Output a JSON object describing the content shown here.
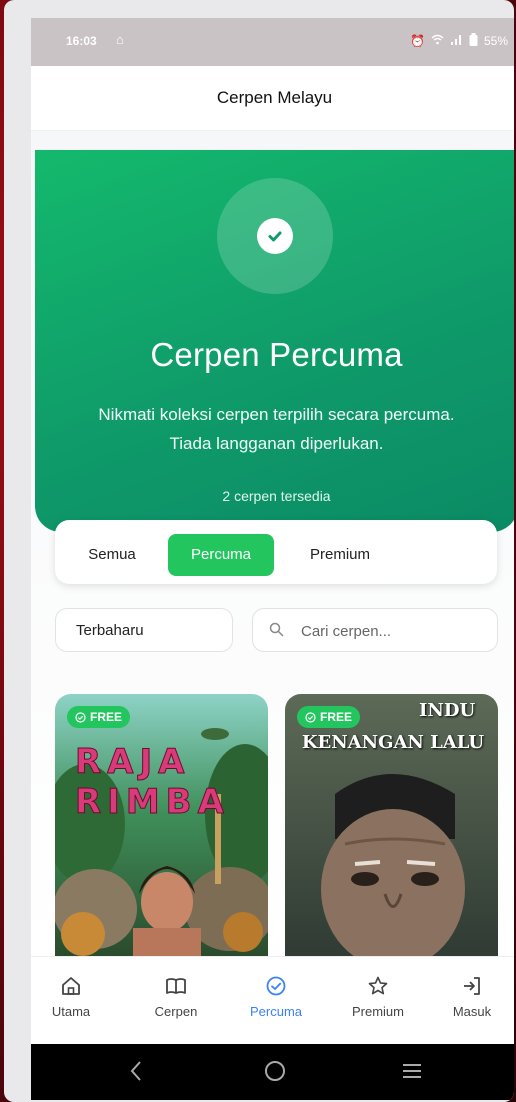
{
  "status_bar": {
    "time": "16:03",
    "battery": "55%"
  },
  "app_title": "Cerpen Melayu",
  "hero": {
    "title": "Cerpen Percuma",
    "description": "Nikmati koleksi cerpen terpilih secara percuma. Tiada langganan diperlukan.",
    "count_text": "2 cerpen tersedia",
    "accent_color": "#14b96c"
  },
  "tabs": [
    {
      "label": "Semua",
      "active": false
    },
    {
      "label": "Percuma",
      "active": true
    },
    {
      "label": "Premium",
      "active": false
    }
  ],
  "filters": {
    "sort_value": "Terbaharu",
    "search_placeholder": "Cari cerpen..."
  },
  "stories": [
    {
      "badge": "FREE",
      "cover_text_lines": [
        "RAJA",
        "RIMBA"
      ]
    },
    {
      "badge": "FREE",
      "cover_text_top": "INDU",
      "cover_text": "KENANGAN LALU"
    }
  ],
  "bottom_nav": [
    {
      "label": "Utama",
      "icon": "home-icon",
      "active": false
    },
    {
      "label": "Cerpen",
      "icon": "book-icon",
      "active": false
    },
    {
      "label": "Percuma",
      "icon": "check-circle-icon",
      "active": true
    },
    {
      "label": "Premium",
      "icon": "star-icon",
      "active": false
    },
    {
      "label": "Masuk",
      "icon": "login-icon",
      "active": false
    }
  ],
  "colors": {
    "primary_green": "#22c55e",
    "active_nav_blue": "#3b82f6"
  }
}
